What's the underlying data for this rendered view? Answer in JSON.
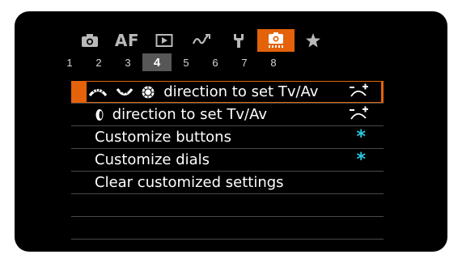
{
  "tabs": [
    {
      "name": "shooting",
      "icon": "camera-icon",
      "active": false
    },
    {
      "name": "af",
      "label": "AF",
      "active": false
    },
    {
      "name": "playback",
      "icon": "playback-icon",
      "active": false
    },
    {
      "name": "wireless",
      "icon": "wireless-icon",
      "active": false
    },
    {
      "name": "setup",
      "icon": "wrench-icon",
      "active": false
    },
    {
      "name": "custom-functions",
      "icon": "custom-functions-icon",
      "active": true
    },
    {
      "name": "my-menu",
      "icon": "star-icon",
      "active": false
    }
  ],
  "pages": [
    "1",
    "2",
    "3",
    "4",
    "5",
    "6",
    "7",
    "8"
  ],
  "active_page": "4",
  "menu": {
    "items": [
      {
        "label": "direction to set Tv/Av",
        "icons": [
          "main-dial-icon",
          "quick-control-dial-icon",
          "control-ring-icon"
        ],
        "value_icon": "dial-direction-icon",
        "selected": true
      },
      {
        "label": "direction to set Tv/Av",
        "icons": [
          "control-dial-icon"
        ],
        "value_icon": "dial-direction-icon",
        "selected": false
      },
      {
        "label": "Customize buttons",
        "value": "*",
        "selected": false
      },
      {
        "label": "Customize dials",
        "value": "*",
        "selected": false
      },
      {
        "label": "Clear customized settings",
        "value": "",
        "selected": false
      }
    ]
  },
  "colors": {
    "accent": "#e3620a",
    "value_asterisk": "#29c8e0",
    "background": "#000000"
  }
}
